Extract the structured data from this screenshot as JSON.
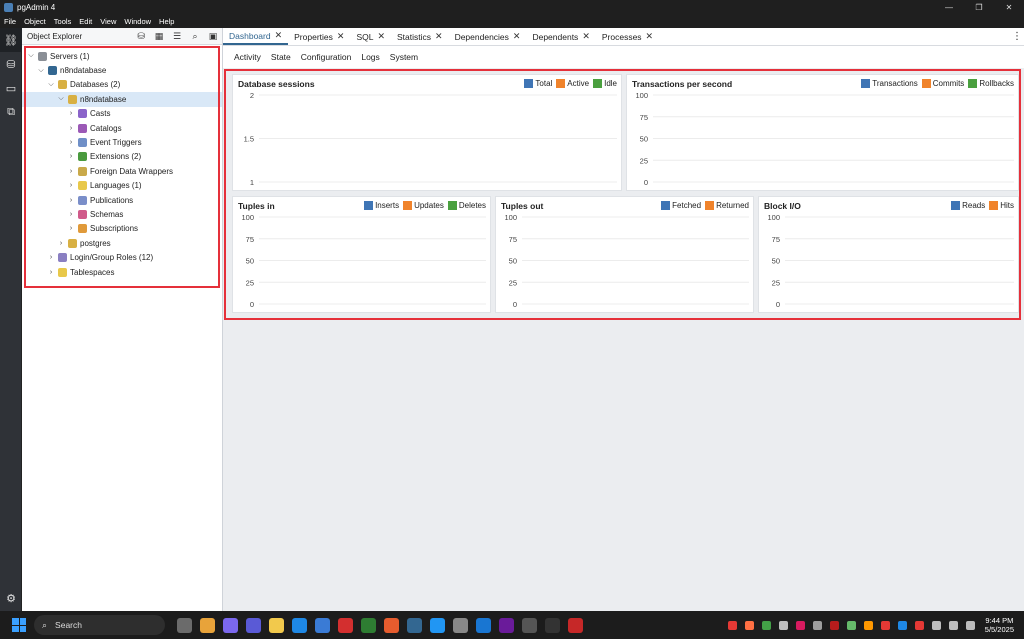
{
  "window": {
    "title": "pgAdmin 4",
    "minimize": "—",
    "maximize": "❐",
    "close": "✕"
  },
  "menu": [
    "File",
    "Object",
    "Tools",
    "Edit",
    "View",
    "Window",
    "Help"
  ],
  "explorer": {
    "title": "Object Explorer",
    "tree": [
      {
        "label": "Servers (1)",
        "level": 0,
        "expanded": true,
        "icon": "server-group-icon",
        "color": "#8a8f96"
      },
      {
        "label": "n8ndatabase",
        "level": 1,
        "expanded": true,
        "icon": "server-icon",
        "color": "#336791"
      },
      {
        "label": "Databases (2)",
        "level": 2,
        "expanded": true,
        "icon": "databases-icon",
        "color": "#d8b043"
      },
      {
        "label": "n8ndatabase",
        "level": 3,
        "expanded": true,
        "icon": "database-icon",
        "color": "#d8b043",
        "selected": true
      },
      {
        "label": "Casts",
        "level": 4,
        "expanded": false,
        "icon": "casts-icon",
        "color": "#8a63c9"
      },
      {
        "label": "Catalogs",
        "level": 4,
        "expanded": false,
        "icon": "catalogs-icon",
        "color": "#9b59b6"
      },
      {
        "label": "Event Triggers",
        "level": 4,
        "expanded": false,
        "icon": "event-triggers-icon",
        "color": "#6f8fc7"
      },
      {
        "label": "Extensions (2)",
        "level": 4,
        "expanded": false,
        "icon": "extensions-icon",
        "color": "#4a9a3e"
      },
      {
        "label": "Foreign Data Wrappers",
        "level": 4,
        "expanded": false,
        "icon": "foreign-data-wrappers-icon",
        "color": "#c9a94a"
      },
      {
        "label": "Languages (1)",
        "level": 4,
        "expanded": false,
        "icon": "languages-icon",
        "color": "#e8c84a"
      },
      {
        "label": "Publications",
        "level": 4,
        "expanded": false,
        "icon": "publications-icon",
        "color": "#7a8ec9"
      },
      {
        "label": "Schemas",
        "level": 4,
        "expanded": false,
        "icon": "schemas-icon",
        "color": "#d05a8a"
      },
      {
        "label": "Subscriptions",
        "level": 4,
        "expanded": false,
        "icon": "subscriptions-icon",
        "color": "#e09a3a"
      },
      {
        "label": "postgres",
        "level": 3,
        "expanded": false,
        "icon": "database-icon",
        "color": "#d8b043"
      },
      {
        "label": "Login/Group Roles (12)",
        "level": 2,
        "expanded": false,
        "icon": "roles-icon",
        "color": "#8a7fc2"
      },
      {
        "label": "Tablespaces",
        "level": 2,
        "expanded": false,
        "icon": "tablespaces-icon",
        "color": "#e8c84a"
      }
    ]
  },
  "tabs": [
    {
      "label": "Dashboard",
      "active": true
    },
    {
      "label": "Properties"
    },
    {
      "label": "SQL"
    },
    {
      "label": "Statistics"
    },
    {
      "label": "Dependencies"
    },
    {
      "label": "Dependents"
    },
    {
      "label": "Processes"
    }
  ],
  "subtabs": [
    "Activity",
    "State",
    "Configuration",
    "Logs",
    "System"
  ],
  "colors": {
    "blue": "#3f75b5",
    "orange": "#f0832b",
    "green": "#4aa03f",
    "highlight": "#e5303a"
  },
  "chart_data": [
    {
      "type": "line",
      "title": "Database sessions",
      "series": [
        {
          "name": "Total",
          "color": "#3f75b5",
          "values": []
        },
        {
          "name": "Active",
          "color": "#f0832b",
          "values": []
        },
        {
          "name": "Idle",
          "color": "#4aa03f",
          "values": []
        }
      ],
      "yticks": [
        "2",
        "1.5",
        "1"
      ],
      "ylim": [
        1,
        2
      ],
      "grid": true,
      "legend": "top-right"
    },
    {
      "type": "line",
      "title": "Transactions per second",
      "series": [
        {
          "name": "Transactions",
          "color": "#3f75b5",
          "values": []
        },
        {
          "name": "Commits",
          "color": "#f0832b",
          "values": []
        },
        {
          "name": "Rollbacks",
          "color": "#4aa03f",
          "values": []
        }
      ],
      "yticks": [
        "100",
        "75",
        "50",
        "25",
        "0"
      ],
      "ylim": [
        0,
        100
      ],
      "grid": true,
      "legend": "top-right"
    },
    {
      "type": "line",
      "title": "Tuples in",
      "series": [
        {
          "name": "Inserts",
          "color": "#3f75b5",
          "values": []
        },
        {
          "name": "Updates",
          "color": "#f0832b",
          "values": []
        },
        {
          "name": "Deletes",
          "color": "#4aa03f",
          "values": []
        }
      ],
      "yticks": [
        "100",
        "75",
        "50",
        "25",
        "0"
      ],
      "ylim": [
        0,
        100
      ],
      "grid": true,
      "legend": "top-right"
    },
    {
      "type": "line",
      "title": "Tuples out",
      "series": [
        {
          "name": "Fetched",
          "color": "#3f75b5",
          "values": []
        },
        {
          "name": "Returned",
          "color": "#f0832b",
          "values": []
        }
      ],
      "yticks": [
        "100",
        "75",
        "50",
        "25",
        "0"
      ],
      "ylim": [
        0,
        100
      ],
      "grid": true,
      "legend": "top-right"
    },
    {
      "type": "line",
      "title": "Block I/O",
      "series": [
        {
          "name": "Reads",
          "color": "#3f75b5",
          "values": []
        },
        {
          "name": "Hits",
          "color": "#f0832b",
          "values": []
        }
      ],
      "yticks": [
        "100",
        "75",
        "50",
        "25",
        "0"
      ],
      "ylim": [
        0,
        100
      ],
      "grid": true,
      "legend": "top-right"
    }
  ],
  "taskbar": {
    "search_label": "Search",
    "time": "9:44 PM",
    "date": "5/5/2025",
    "apps": [
      "#6b6b6b",
      "#e8a33a",
      "#7b68ee",
      "#5a5ad6",
      "#f2c94c",
      "#1e88e5",
      "#3a7bd5",
      "#d32f2f",
      "#2e7d32",
      "#e65c2e",
      "#336791",
      "#2196f3",
      "#888888",
      "#1976d2",
      "#6a1b9a",
      "#555555",
      "#333333",
      "#c62828"
    ],
    "tray": [
      "#e53935",
      "#ff7043",
      "#43a047",
      "#bdbdbd",
      "#d81b60",
      "#9e9e9e",
      "#b71c1c",
      "#66bb6a",
      "#ff9800",
      "#e53935",
      "#1e88e5",
      "#e53935",
      "#bdbdbd",
      "#bdbdbd",
      "#bdbdbd"
    ]
  }
}
